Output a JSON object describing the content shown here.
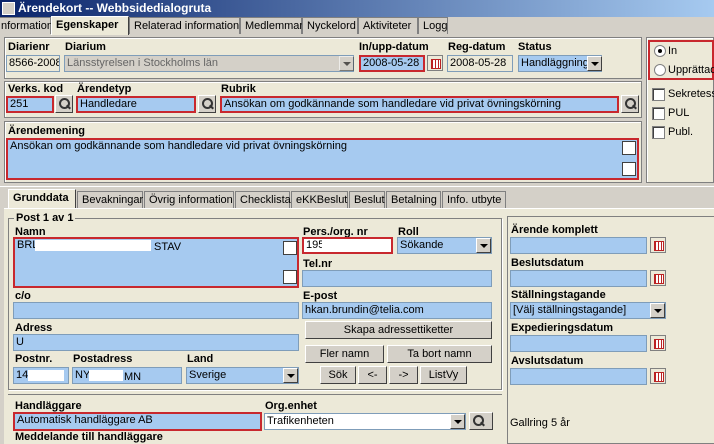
{
  "window": {
    "title": "Ärendekort -- Webbsidedialogruta"
  },
  "top_tabs": [
    "nformation",
    "Egenskaper",
    "Relaterad information",
    "Medlemmar",
    "Nyckelord",
    "Aktiviteter",
    "Logg"
  ],
  "header": {
    "diarienr_label": "Diarienr",
    "diarienr": "8566-2008",
    "diarium_label": "Diarium",
    "diarium": "Länsstyrelsen i Stockholms län",
    "in_upp_label": "In/upp-datum",
    "in_upp": "2008-05-28",
    "reg_label": "Reg-datum",
    "reg": "2008-05-28",
    "status_label": "Status",
    "status": "Handläggning"
  },
  "direction": {
    "in": "In",
    "upprattad": "Upprättad"
  },
  "row2": {
    "verks_label": "Verks. kod",
    "verks": "251",
    "arendetyp_label": "Ärendetyp",
    "arendetyp": "Handledare",
    "rubrik_label": "Rubrik",
    "rubrik": "Ansökan om godkännande som handledare vid privat övningskörning"
  },
  "flags": {
    "sekretess": "Sekretess",
    "pul": "PUL",
    "publ": "Publ."
  },
  "arendemening": {
    "label": "Ärendemening",
    "text": "Ansökan om godkännande som handledare vid privat övningskörning"
  },
  "sub_tabs": [
    "Grunddata",
    "Bevakningar",
    "Övrig information",
    "Checklista",
    "eKKBeslut",
    "Beslut",
    "Betalning",
    "Info. utbyte"
  ],
  "post": {
    "counter": "Post 1 av 1",
    "namn_label": "Namn",
    "namn_prefix": "BRL",
    "namn_suffix": "STAV",
    "pers_label": "Pers./org. nr",
    "pers": "195",
    "roll_label": "Roll",
    "roll": "Sökande",
    "tel_label": "Tel.nr",
    "co_label": "c/o",
    "epost_label": "E-post",
    "epost": "hkan.brundin@telia.com",
    "adress_label": "Adress",
    "adress": "U",
    "skapa_btn": "Skapa adressettiketter",
    "fler_btn": "Fler namn",
    "tabort_btn": "Ta bort namn",
    "sok_btn": "Sök",
    "prev_btn": "<-",
    "next_btn": "->",
    "listvy_btn": "ListVy",
    "postnr_label": "Postnr.",
    "postnr": "14",
    "postadress_label": "Postadress",
    "postadress_a": "NY",
    "postadress_b": "MN",
    "land_label": "Land",
    "land": "Sverige"
  },
  "handlaggare": {
    "label": "Handläggare",
    "value": "Automatisk handläggare AB",
    "org_label": "Org.enhet",
    "org": "Trafikenheten",
    "meddelande_label": "Meddelande till handläggare"
  },
  "right_panel": {
    "komplett_label": "Ärende komplett",
    "beslutsdatum_label": "Beslutsdatum",
    "stallning_label": "Ställningstagande",
    "stallning": "[Välj ställningstagande]",
    "expediering_label": "Expedieringsdatum",
    "avslut_label": "Avslutsdatum",
    "gallring": "Gallring 5 år"
  }
}
